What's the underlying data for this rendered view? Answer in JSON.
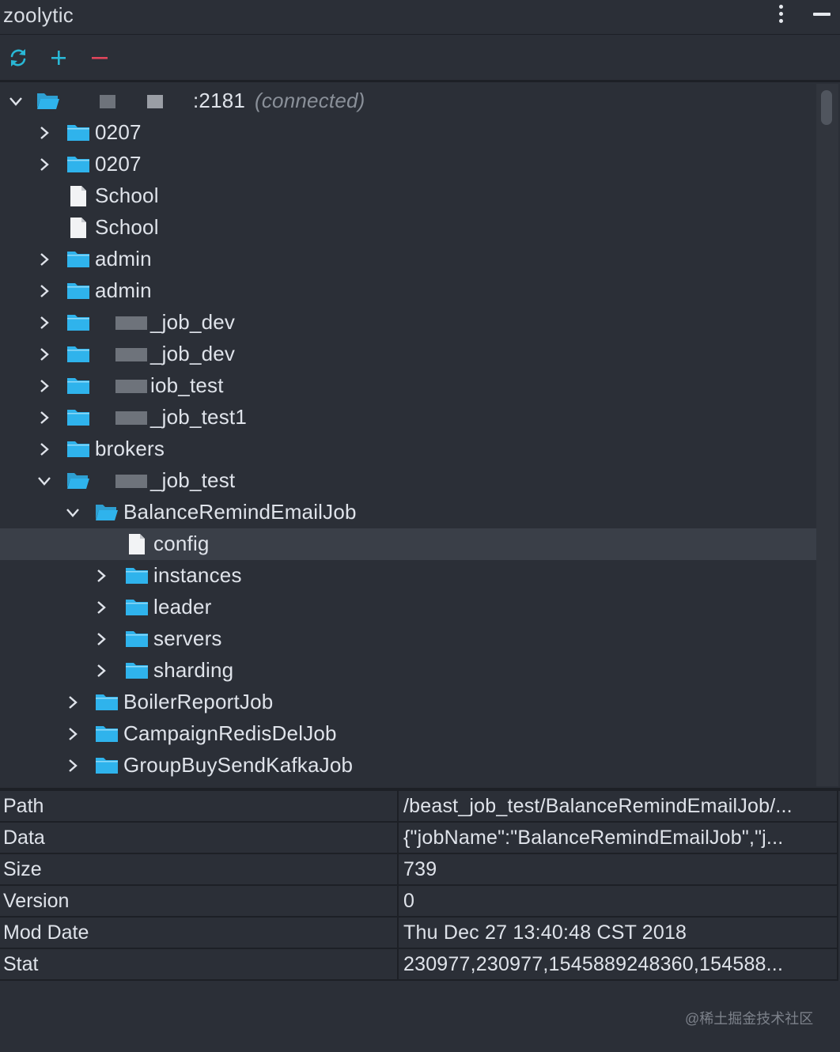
{
  "app": {
    "title": "zoolytic"
  },
  "toolbar": {
    "refresh_icon": "refresh-icon",
    "add_icon": "plus-icon",
    "remove_icon": "minus-icon",
    "colors": {
      "refresh": "#29b8d6",
      "add": "#29b8d6",
      "remove": "#e0465b"
    }
  },
  "tree": {
    "selected_row": 14,
    "rows": [
      {
        "depth": 0,
        "type": "folder",
        "expanded": true,
        "prefix": "",
        "masked": "host",
        "label": ":2181",
        "status": "(connected)"
      },
      {
        "depth": 1,
        "type": "folder",
        "expanded": false,
        "prefix": "",
        "masked": "",
        "label": "0207"
      },
      {
        "depth": 1,
        "type": "folder",
        "expanded": false,
        "prefix": "",
        "masked": "",
        "label": "0207"
      },
      {
        "depth": 1,
        "type": "file",
        "prefix": "",
        "masked": "",
        "label": "School"
      },
      {
        "depth": 1,
        "type": "file",
        "prefix": "",
        "masked": "",
        "label": "School"
      },
      {
        "depth": 1,
        "type": "folder",
        "expanded": false,
        "prefix": "",
        "masked": "",
        "label": "admin"
      },
      {
        "depth": 1,
        "type": "folder",
        "expanded": false,
        "prefix": "",
        "masked": "",
        "label": "admin"
      },
      {
        "depth": 1,
        "type": "folder",
        "expanded": false,
        "masked": "name",
        "label": "_job_dev"
      },
      {
        "depth": 1,
        "type": "folder",
        "expanded": false,
        "masked": "name",
        "label": "_job_dev"
      },
      {
        "depth": 1,
        "type": "folder",
        "expanded": false,
        "masked": "name",
        "label": "iob_test"
      },
      {
        "depth": 1,
        "type": "folder",
        "expanded": false,
        "masked": "name",
        "label": "_job_test1"
      },
      {
        "depth": 1,
        "type": "folder",
        "expanded": false,
        "masked": "",
        "label": "brokers"
      },
      {
        "depth": 1,
        "type": "folder",
        "expanded": true,
        "masked": "name",
        "label": "_job_test"
      },
      {
        "depth": 2,
        "type": "folder",
        "expanded": true,
        "masked": "",
        "label": "BalanceRemindEmailJob"
      },
      {
        "depth": 3,
        "type": "file",
        "masked": "",
        "label": "config"
      },
      {
        "depth": 3,
        "type": "folder",
        "expanded": false,
        "masked": "",
        "label": "instances"
      },
      {
        "depth": 3,
        "type": "folder",
        "expanded": false,
        "masked": "",
        "label": "leader"
      },
      {
        "depth": 3,
        "type": "folder",
        "expanded": false,
        "masked": "",
        "label": "servers"
      },
      {
        "depth": 3,
        "type": "folder",
        "expanded": false,
        "masked": "",
        "label": "sharding"
      },
      {
        "depth": 2,
        "type": "folder",
        "expanded": false,
        "masked": "",
        "label": "BoilerReportJob"
      },
      {
        "depth": 2,
        "type": "folder",
        "expanded": false,
        "masked": "",
        "label": "CampaignRedisDelJob"
      },
      {
        "depth": 2,
        "type": "folder",
        "expanded": false,
        "masked": "",
        "label": "GroupBuySendKafkaJob"
      }
    ]
  },
  "properties": {
    "rows": [
      {
        "key": "Path",
        "value": "/beast_job_test/BalanceRemindEmailJob/..."
      },
      {
        "key": "Data",
        "value": "{\"jobName\":\"BalanceRemindEmailJob\",\"j..."
      },
      {
        "key": "Size",
        "value": "739"
      },
      {
        "key": "Version",
        "value": "0"
      },
      {
        "key": "Mod Date",
        "value": "Thu Dec 27 13:40:48 CST 2018"
      },
      {
        "key": "Stat",
        "value": "230977,230977,1545889248360,154588..."
      }
    ]
  },
  "watermark": "@稀土掘金技术社区",
  "colors": {
    "folder": "#2fb3ec",
    "background": "#2b2f37",
    "selected_row": "#3a3f48"
  }
}
